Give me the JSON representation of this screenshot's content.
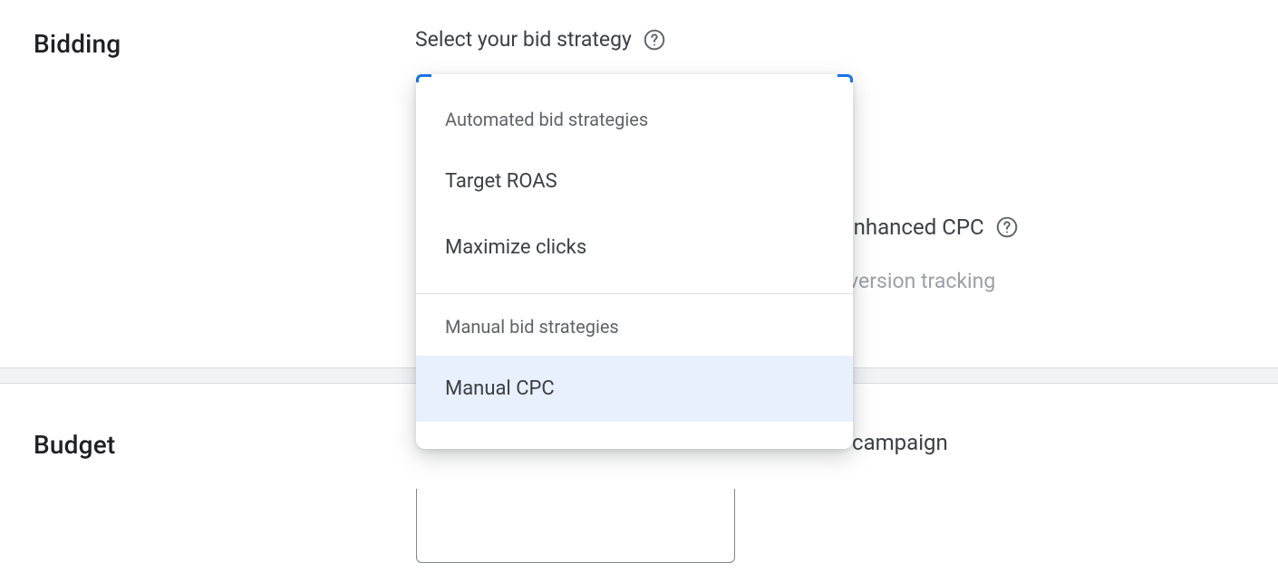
{
  "bidding": {
    "section_label": "Bidding",
    "select_label": "Select your bid strategy",
    "behind_ecpc": "Enhanced CPC",
    "behind_conversion": "version tracking"
  },
  "dropdown": {
    "group1_header": "Automated bid strategies",
    "option_target_roas": "Target ROAS",
    "option_maximize_clicks": "Maximize clicks",
    "group2_header": "Manual bid strategies",
    "option_manual_cpc": "Manual CPC"
  },
  "budget": {
    "section_label": "Budget",
    "behind_campaign": "campaign"
  }
}
